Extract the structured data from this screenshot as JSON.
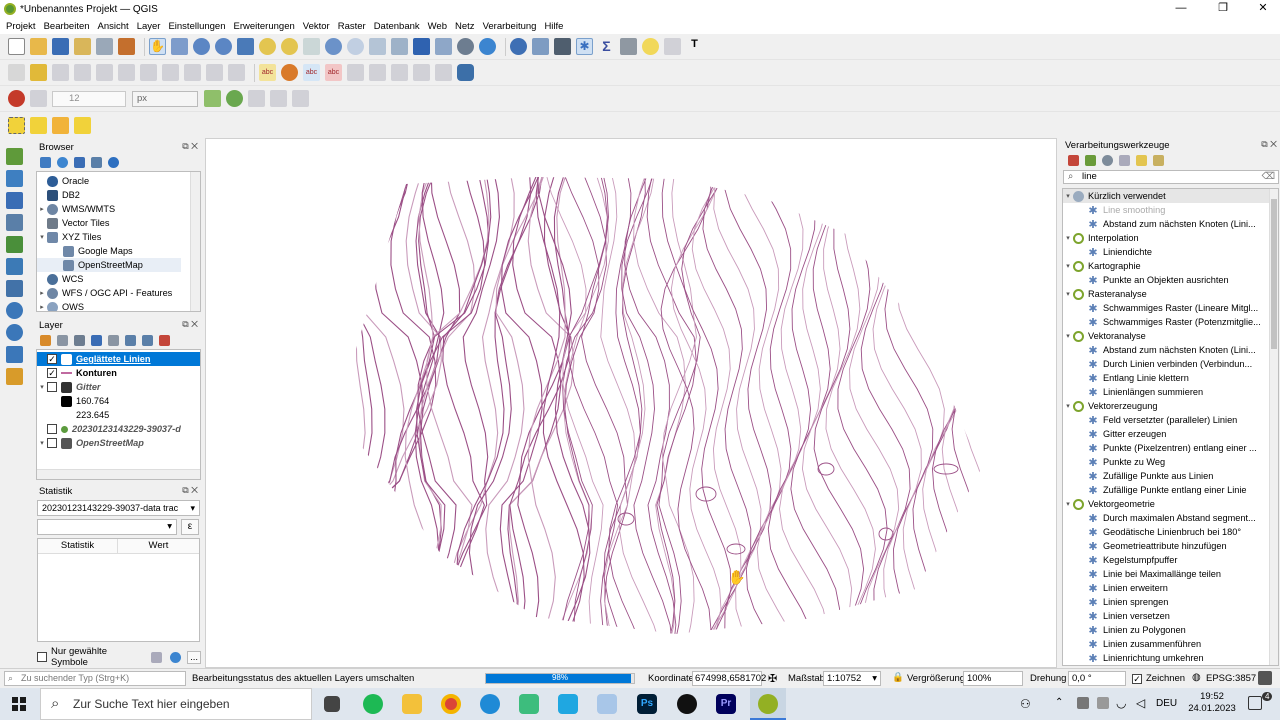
{
  "window": {
    "title": "*Unbenanntes Projekt — QGIS",
    "controls": [
      "—",
      "❐",
      "✕"
    ]
  },
  "menu": [
    "Projekt",
    "Bearbeiten",
    "Ansicht",
    "Layer",
    "Einstellungen",
    "Erweiterungen",
    "Vektor",
    "Raster",
    "Datenbank",
    "Web",
    "Netz",
    "Verarbeitung",
    "Hilfe"
  ],
  "toolbar3": {
    "size_value": "12",
    "unit_value": "px"
  },
  "browser": {
    "title": "Browser",
    "items": [
      {
        "label": "Oracle",
        "level": 0,
        "expand": ""
      },
      {
        "label": "DB2",
        "level": 0,
        "expand": ""
      },
      {
        "label": "WMS/WMTS",
        "level": 0,
        "expand": "▸"
      },
      {
        "label": "Vector Tiles",
        "level": 0,
        "expand": ""
      },
      {
        "label": "XYZ Tiles",
        "level": 0,
        "expand": "▾"
      },
      {
        "label": "Google Maps",
        "level": 1,
        "expand": ""
      },
      {
        "label": "OpenStreetMap",
        "level": 1,
        "expand": ""
      },
      {
        "label": "WCS",
        "level": 0,
        "expand": ""
      },
      {
        "label": "WFS / OGC API - Features",
        "level": 0,
        "expand": "▸"
      },
      {
        "label": "OWS",
        "level": 0,
        "expand": "▸"
      }
    ]
  },
  "layers": {
    "title": "Layer",
    "items": [
      {
        "label": "Geglättete Linien",
        "checked": "✓"
      },
      {
        "label": "Konturen",
        "checked": "✓"
      },
      {
        "label": "Gitter",
        "checked": ""
      },
      {
        "label": "160.764",
        "checked": ""
      },
      {
        "label": "223.645",
        "checked": ""
      },
      {
        "label": "20230123143229-39037-d",
        "checked": ""
      },
      {
        "label": "OpenStreetMap",
        "checked": ""
      }
    ]
  },
  "statistics": {
    "title": "Statistik",
    "layer_select": "20230123143229-39037-data trac",
    "field_select": "",
    "expr_button": "ε",
    "col_statistic": "Statistik",
    "col_value": "Wert",
    "selected_only_label": "Nur gewählte Symbole",
    "more_button": "..."
  },
  "processing": {
    "title": "Verarbeitungswerkzeuge",
    "search_value": "line",
    "groups": [
      {
        "label": "Kürzlich verwendet",
        "items": [
          "Line smoothing",
          "Abstand zum nächsten Knoten (Lini..."
        ]
      },
      {
        "label": "Interpolation",
        "items": [
          "Liniendichte"
        ]
      },
      {
        "label": "Kartographie",
        "items": [
          "Punkte an Objekten ausrichten"
        ]
      },
      {
        "label": "Rasteranalyse",
        "items": [
          "Schwammiges Raster (Lineare Mitgl...",
          "Schwammiges Raster (Potenzmitglie..."
        ]
      },
      {
        "label": "Vektoranalyse",
        "items": [
          "Abstand zum nächsten Knoten (Lini...",
          "Durch Linien verbinden (Verbindun...",
          "Entlang Linie klettern",
          "Linienlängen summieren"
        ]
      },
      {
        "label": "Vektorerzeugung",
        "items": [
          "Feld versetzter (paralleler) Linien",
          "Gitter erzeugen",
          "Punkte (Pixelzentren) entlang einer ...",
          "Punkte zu Weg",
          "Zufällige Punkte aus Linien",
          "Zufällige Punkte entlang einer Linie"
        ]
      },
      {
        "label": "Vektorgeometrie",
        "items": [
          "Durch maximalen Abstand segment...",
          "Geodätische Linienbruch bei 180°",
          "Geometrieattribute hinzufügen",
          "Kegelstumpfpuffer",
          "Linie bei Maximallänge teilen",
          "Linien erweitern",
          "Linien sprengen",
          "Linien versetzen",
          "Linien zu Polygonen",
          "Linien zusammenführen",
          "Linienrichtung umkehren"
        ]
      }
    ]
  },
  "status": {
    "search_placeholder": "Zu suchender Typ (Strg+K)",
    "message": "Bearbeitungsstatus des aktuellen Layers umschalten",
    "progress_text": "98%",
    "progress": 0.98,
    "coord_label": "Koordinate",
    "coord_value": "674998,6581702",
    "scale_label": "Maßstab",
    "scale_value": "1:10752",
    "zoom_label": "Vergrößerung",
    "zoom_value": "100%",
    "rotation_label": "Drehung",
    "rotation_value": "0,0 °",
    "render_label": "Zeichnen",
    "render_checked": "✓",
    "crs": "EPSG:3857"
  },
  "taskbar": {
    "search_placeholder": "Zur Suche Text hier eingeben",
    "language": "DEU",
    "time": "19:52",
    "date": "24.01.2023",
    "notify_count": "4"
  },
  "colors": {
    "contour": "#9b4f86",
    "contour_light": "#c99bbb",
    "selection": "#0078d7",
    "qgis_green": "#589632"
  }
}
